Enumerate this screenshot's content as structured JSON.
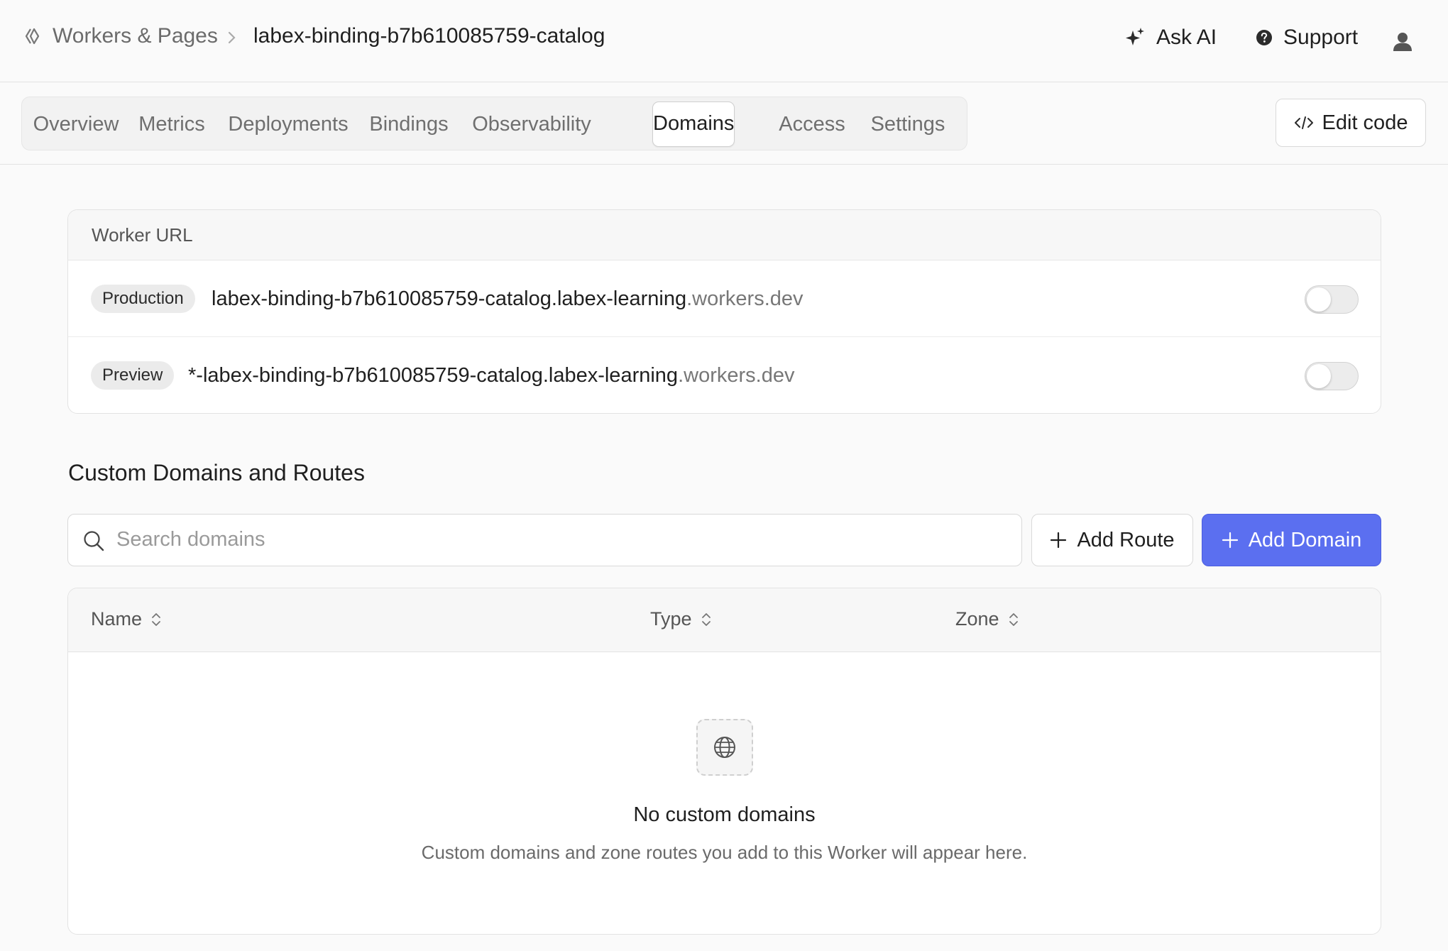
{
  "breadcrumb": {
    "root": "Workers & Pages",
    "current": "labex-binding-b7b610085759-catalog",
    "root_icon": "workers-icon",
    "separator_icon": "chevron-right-icon"
  },
  "header": {
    "ask_ai": "Ask AI",
    "support": "Support",
    "ask_ai_icon": "sparkle-icon",
    "support_icon": "help-circle-icon",
    "avatar_icon": "user-icon"
  },
  "tabs": [
    {
      "label": "Overview",
      "active": false
    },
    {
      "label": "Metrics",
      "active": false
    },
    {
      "label": "Deployments",
      "active": false
    },
    {
      "label": "Bindings",
      "active": false
    },
    {
      "label": "Observability",
      "active": false
    },
    {
      "label": "Domains",
      "active": true
    },
    {
      "label": "Access",
      "active": false
    },
    {
      "label": "Settings",
      "active": false
    }
  ],
  "edit_code": {
    "label": "Edit code",
    "icon": "code-icon"
  },
  "worker_url": {
    "title": "Worker URL",
    "rows": [
      {
        "badge": "Production",
        "host": "labex-binding-b7b610085759-catalog.labex-learning",
        "suffix": ".workers.dev",
        "enabled": false
      },
      {
        "badge": "Preview",
        "host": "*-labex-binding-b7b610085759-catalog.labex-learning",
        "suffix": ".workers.dev",
        "enabled": false
      }
    ]
  },
  "custom_domains": {
    "title": "Custom Domains and Routes",
    "search": {
      "placeholder": "Search domains",
      "value": "",
      "icon": "search-icon"
    },
    "add_route": {
      "label": "Add Route",
      "icon": "plus-icon"
    },
    "add_domain": {
      "label": "Add Domain",
      "icon": "plus-icon"
    },
    "columns": [
      "Name",
      "Type",
      "Zone"
    ],
    "sort_icon": "sort-icon",
    "empty": {
      "icon": "globe-icon",
      "title": "No custom domains",
      "description": "Custom domains and zone routes you add to this Worker will appear here."
    }
  },
  "colors": {
    "primary": "#5b6ff0",
    "border": "#e3e3e3",
    "background": "#fafafa"
  }
}
